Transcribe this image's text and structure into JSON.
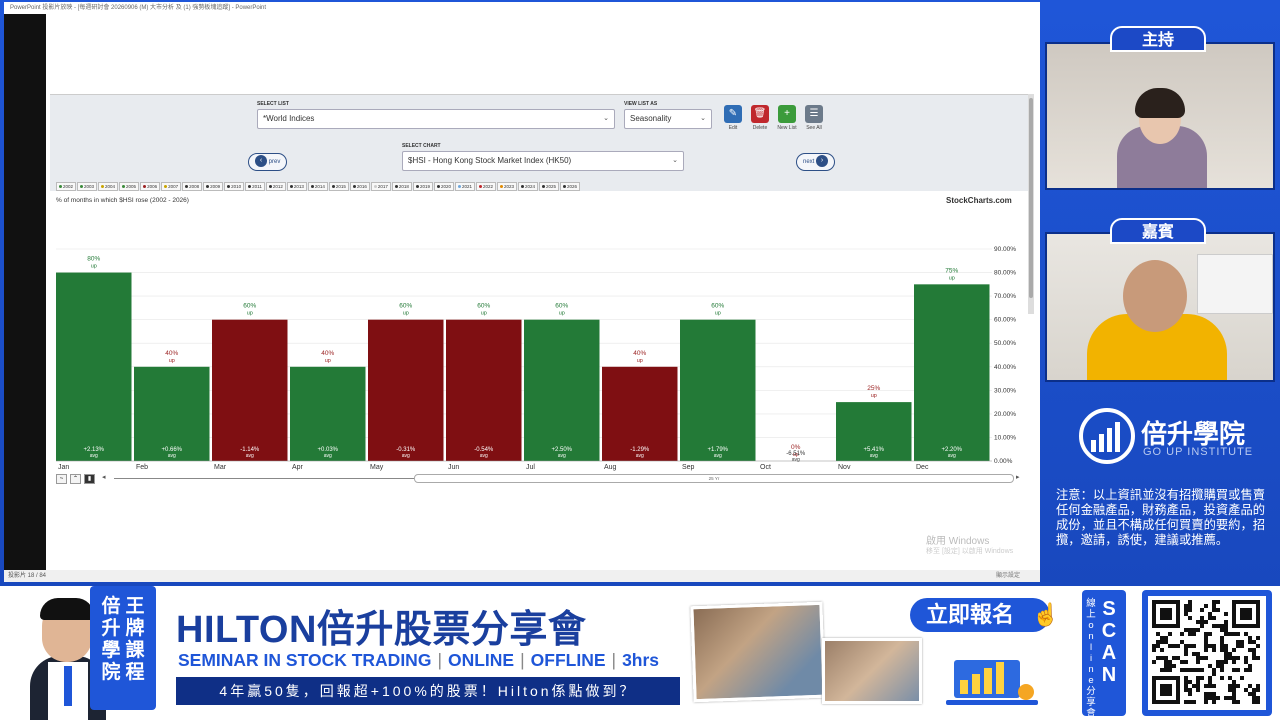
{
  "ppt": {
    "titlebar": "PowerPoint 投影片放映 - [每週研討會 20260906 (M) 大市分析 及 (1) 強勢板塊追蹤] - PowerPoint",
    "status_left": "投影片 18 / 84",
    "status_right": "顯示設定",
    "watermark_title": "啟用 Windows",
    "watermark_sub": "移至 [設定] 以啟用 Windows"
  },
  "stockcharts": {
    "select_list_label": "SELECT LIST",
    "select_list_value": "*World Indices",
    "view_list_label": "VIEW LIST AS",
    "view_list_value": "Seasonality",
    "select_chart_label": "SELECT CHART",
    "select_chart_value": "$HSI - Hong Kong Stock Market Index (HK50)",
    "prev_label": "prev",
    "next_label": "next",
    "tools": [
      {
        "label": "Edit",
        "icon": "pencil-icon",
        "color": "#2f6db5",
        "glyph": "✎"
      },
      {
        "label": "Delete",
        "icon": "trash-icon",
        "color": "#c0282d",
        "glyph": "🗑"
      },
      {
        "label": "New List",
        "icon": "plus-icon",
        "color": "#3b9b3b",
        "glyph": "+"
      },
      {
        "label": "See All",
        "icon": "list-icon",
        "color": "#6c7a8a",
        "glyph": "☰"
      }
    ],
    "years": [
      {
        "y": "2002",
        "c": "#3a8a3a"
      },
      {
        "y": "2003",
        "c": "#3a8a3a"
      },
      {
        "y": "2004",
        "c": "#c8a400"
      },
      {
        "y": "2005",
        "c": "#3a8a3a"
      },
      {
        "y": "2006",
        "c": "#9b2222"
      },
      {
        "y": "2007",
        "c": "#c8a400"
      },
      {
        "y": "2008",
        "c": "#333"
      },
      {
        "y": "2009",
        "c": "#333"
      },
      {
        "y": "2010",
        "c": "#333"
      },
      {
        "y": "2011",
        "c": "#333"
      },
      {
        "y": "2012",
        "c": "#333"
      },
      {
        "y": "2013",
        "c": "#333"
      },
      {
        "y": "2014",
        "c": "#333"
      },
      {
        "y": "2015",
        "c": "#333"
      },
      {
        "y": "2016",
        "c": "#333"
      },
      {
        "y": "2017",
        "c": "#ccc"
      },
      {
        "y": "2018",
        "c": "#333"
      },
      {
        "y": "2019",
        "c": "#333"
      },
      {
        "y": "2020",
        "c": "#333"
      },
      {
        "y": "2021",
        "c": "#6fa8dc"
      },
      {
        "y": "2022",
        "c": "#c0282d"
      },
      {
        "y": "2023",
        "c": "#e08a00"
      },
      {
        "y": "2024",
        "c": "#333"
      },
      {
        "y": "2025",
        "c": "#333"
      },
      {
        "y": "2026",
        "c": "#333"
      }
    ],
    "chart_caption": "% of months in which $HSI rose (2002 - 2026)",
    "brand": "StockCharts.com",
    "scroll_label": "25 Yr"
  },
  "chart_data": {
    "type": "bar",
    "title": "% of months in which $HSI rose (2002 - 2026)",
    "categories": [
      "Jan",
      "Feb",
      "Mar",
      "Apr",
      "May",
      "Jun",
      "Jul",
      "Aug",
      "Sep",
      "Oct",
      "Nov",
      "Dec"
    ],
    "values": [
      80,
      40,
      60,
      40,
      60,
      60,
      60,
      40,
      60,
      0,
      25,
      75
    ],
    "top_labels": [
      "80%",
      "40%",
      "60%",
      "40%",
      "60%",
      "60%",
      "60%",
      "40%",
      "60%",
      "0%",
      "25%",
      "75%"
    ],
    "up_label": "up",
    "avg_values": [
      "+2.13%",
      "+0.66%",
      "-1.14%",
      "+0.03%",
      "-0.31%",
      "-0.54%",
      "+2.50%",
      "-1.29%",
      "+1.79%",
      "-6.51%",
      "+5.41%",
      "+2.20%"
    ],
    "avg_label": "avg",
    "colors": [
      "green",
      "green",
      "red",
      "green",
      "red",
      "red",
      "green",
      "red",
      "green",
      "none",
      "green",
      "green"
    ],
    "green": "#237a37",
    "red": "#7f0f12",
    "ylim": [
      0,
      90
    ],
    "yticks": [
      "0.00%",
      "10.00%",
      "20.00%",
      "30.00%",
      "40.00%",
      "50.00%",
      "60.00%",
      "70.00%",
      "80.00%",
      "90.00%"
    ],
    "grid": true
  },
  "side": {
    "host_badge": "主持",
    "guest_badge": "嘉賓",
    "logo_title": "倍升學院",
    "logo_sub": "GO UP INSTITUTE",
    "disclaimer": "注意：以上資訊並沒有招攬購買或售賣任何金融產品，財務產品，投資產品的成份，並且不構成任何買賣的要約，招攬，邀請，誘使，建議或推薦。"
  },
  "banner": {
    "vertical_col1": "王牌課程",
    "vertical_col2": "倍升學院",
    "title": "HILTON倍升股票分享會",
    "sub_a": "SEMINAR IN STOCK TRADING",
    "sub_b": "ONLINE",
    "sub_c": "OFFLINE",
    "sub_d": "3hrs",
    "strip": "4年贏50隻，回報超+100%的股票！Hilton係點做到？",
    "register": "立即報名",
    "scan": "SCAN",
    "scan_small": "線上online分享會"
  }
}
